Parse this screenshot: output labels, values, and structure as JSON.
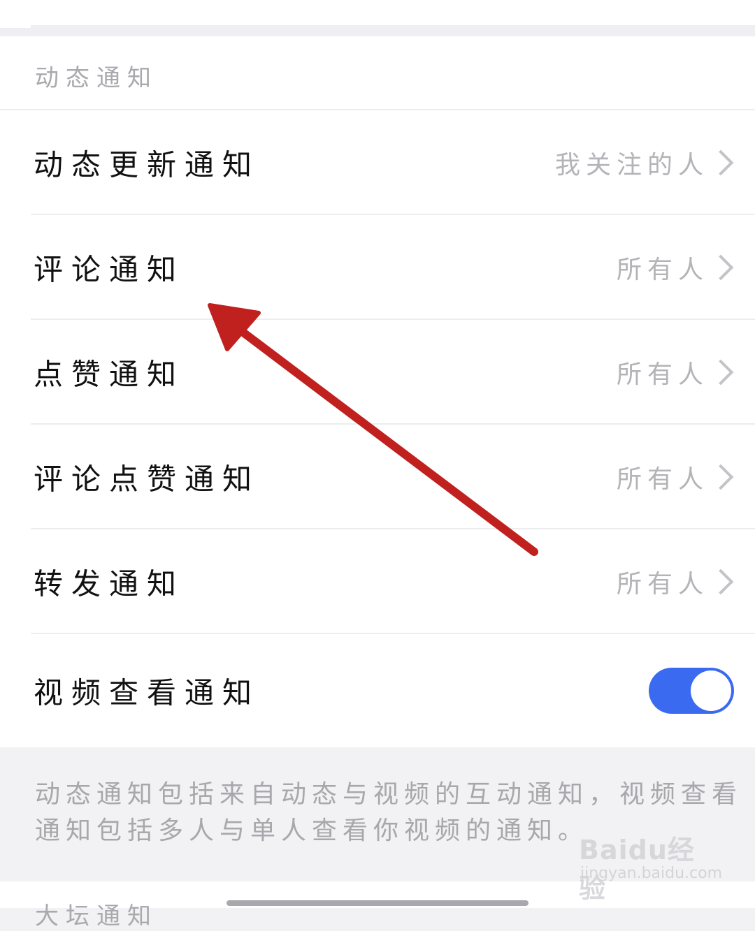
{
  "section": {
    "header": "动态通知",
    "rows": [
      {
        "label": "动态更新通知",
        "value": "我关注的人"
      },
      {
        "label": "评论通知",
        "value": "所有人"
      },
      {
        "label": "点赞通知",
        "value": "所有人"
      },
      {
        "label": "评论点赞通知",
        "value": "所有人"
      },
      {
        "label": "转发通知",
        "value": "所有人"
      }
    ],
    "toggle_row": {
      "label": "视频查看通知",
      "enabled": true
    }
  },
  "footer_note": "动态通知包括来自动态与视频的互动通知，视频查看通知包括多人与单人查看你视频的通知。",
  "next_section_header": "大坛通知",
  "watermark": {
    "brand": "Baidu经验",
    "url": "jingyan.baidu.com"
  },
  "colors": {
    "toggle_on": "#3a6af0",
    "annotation_arrow": "#c0201e"
  },
  "icons": {
    "row_chevron": "chevron-right-icon"
  }
}
